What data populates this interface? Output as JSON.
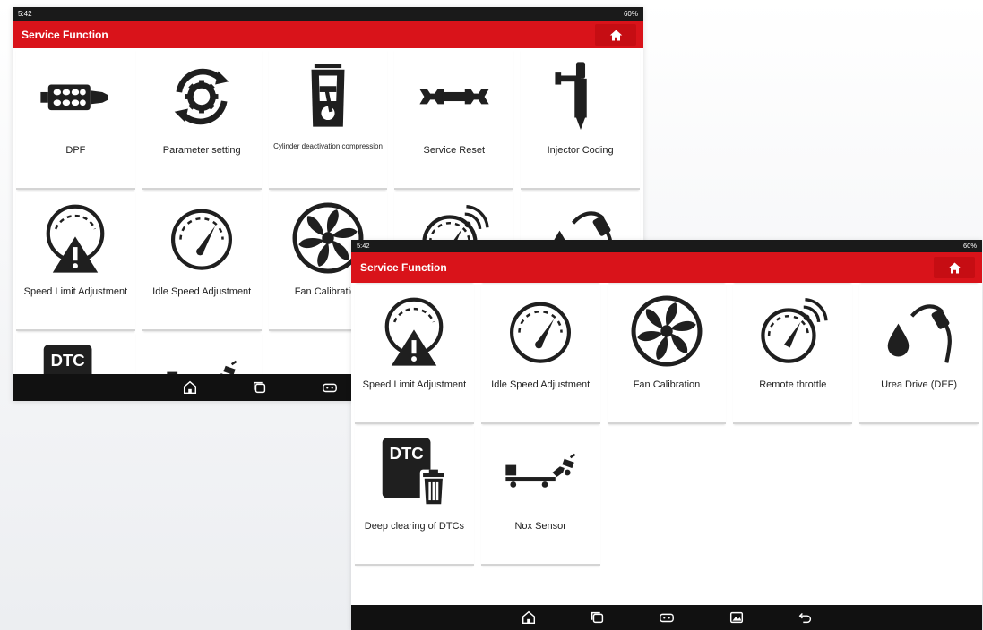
{
  "back_screen": {
    "status": {
      "time": "5:42",
      "battery": "60%"
    },
    "title": "Service Function",
    "tiles": [
      {
        "label": "DPF",
        "icon": "dpf-icon"
      },
      {
        "label": "Parameter setting",
        "icon": "parameter-setting-icon"
      },
      {
        "label": "Cylinder deactivation compression",
        "icon": "cylinder-icon"
      },
      {
        "label": "Service Reset",
        "icon": "wrench-icon"
      },
      {
        "label": "Injector Coding",
        "icon": "injector-icon"
      },
      {
        "label": "Speed Limit Adjustment",
        "icon": "speed-limit-icon"
      },
      {
        "label": "Idle Speed Adjustment",
        "icon": "gauge-icon"
      },
      {
        "label": "Fan Calibration",
        "icon": "fan-icon"
      },
      {
        "label": "Remote throttle",
        "icon": "remote-throttle-icon"
      },
      {
        "label": "Urea Drive (DEF)",
        "icon": "urea-icon"
      },
      {
        "label": "Deep clearing of DTCs",
        "icon": "dtc-icon"
      },
      {
        "label": "Nox Sensor",
        "icon": "nox-sensor-icon"
      }
    ]
  },
  "front_screen": {
    "status": {
      "time": "5:42",
      "battery": "60%"
    },
    "title": "Service Function",
    "tiles": [
      {
        "label": "DPF",
        "icon": "dpf-icon"
      },
      {
        "label": "Parameter setting",
        "icon": "parameter-setting-icon"
      },
      {
        "label": "Cylinder deactivation compression",
        "icon": "cylinder-icon"
      },
      {
        "label": "Service Reset",
        "icon": "wrench-icon"
      },
      {
        "label": "Injector Coding",
        "icon": "injector-icon"
      },
      {
        "label": "Speed Limit Adjustment",
        "icon": "speed-limit-icon"
      },
      {
        "label": "Idle Speed Adjustment",
        "icon": "gauge-icon"
      },
      {
        "label": "Fan Calibration",
        "icon": "fan-icon"
      },
      {
        "label": "Remote throttle",
        "icon": "remote-throttle-icon"
      },
      {
        "label": "Urea Drive (DEF)",
        "icon": "urea-icon"
      },
      {
        "label": "Deep clearing of DTCs",
        "icon": "dtc-icon"
      },
      {
        "label": "Nox Sensor",
        "icon": "nox-sensor-icon"
      }
    ]
  },
  "icon_text": {
    "dtc": "DTC"
  },
  "colors": {
    "accent": "#d9131a",
    "icon": "#1f1f1f",
    "navbar": "#111111"
  }
}
